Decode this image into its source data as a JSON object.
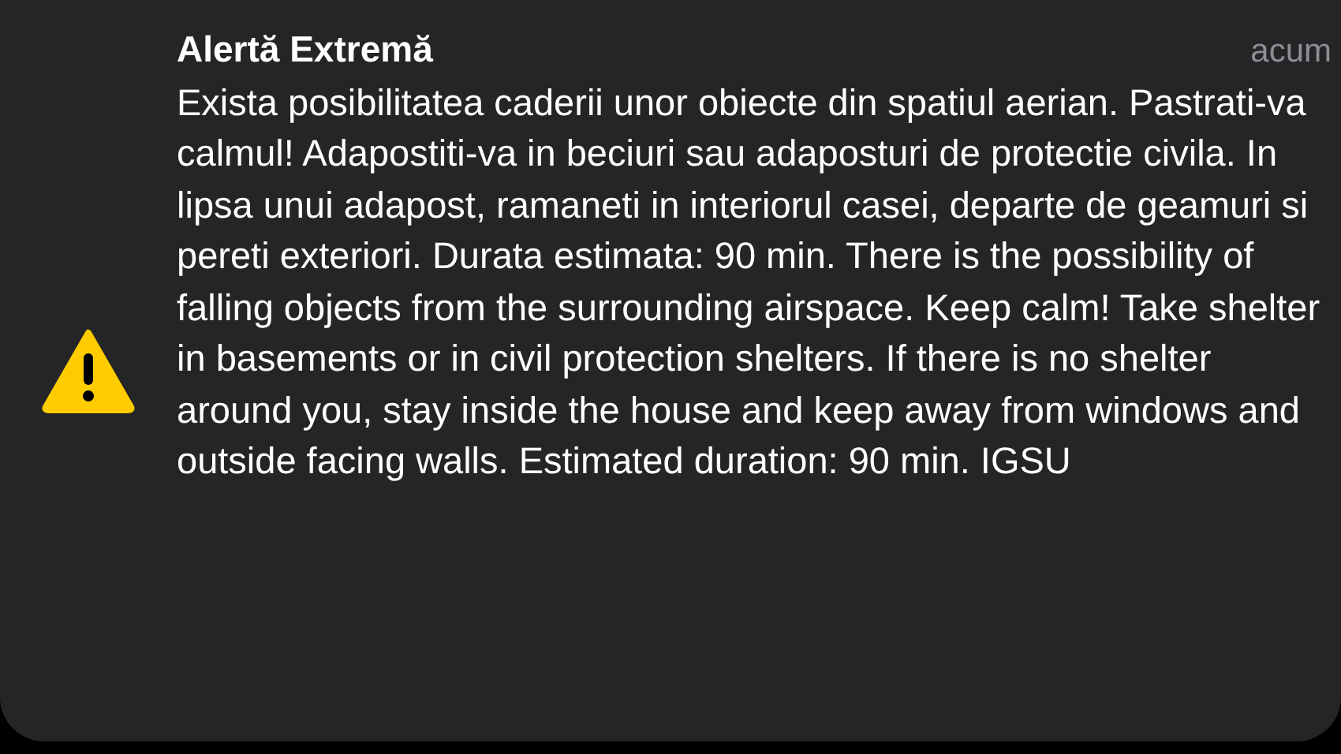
{
  "notification": {
    "title": "Alertă Extremă",
    "time": "acum",
    "body": "Exista posibilitatea caderii unor obiecte din spatiul aerian. Pastrati-va calmul! Adapostiti-va in beciuri sau adaposturi de protectie civila. In lipsa unui adapost, ramaneti in interiorul casei, departe de geamuri si pereti exteriori. Durata estimata: 90 min. There is the possibility of falling objects from the surrounding airspace. Keep calm! Take shelter in basements or in civil protection shelters. If there is no shelter around you, stay inside the house and keep away from windows and outside facing walls. Estimated duration: 90 min. IGSU"
  }
}
